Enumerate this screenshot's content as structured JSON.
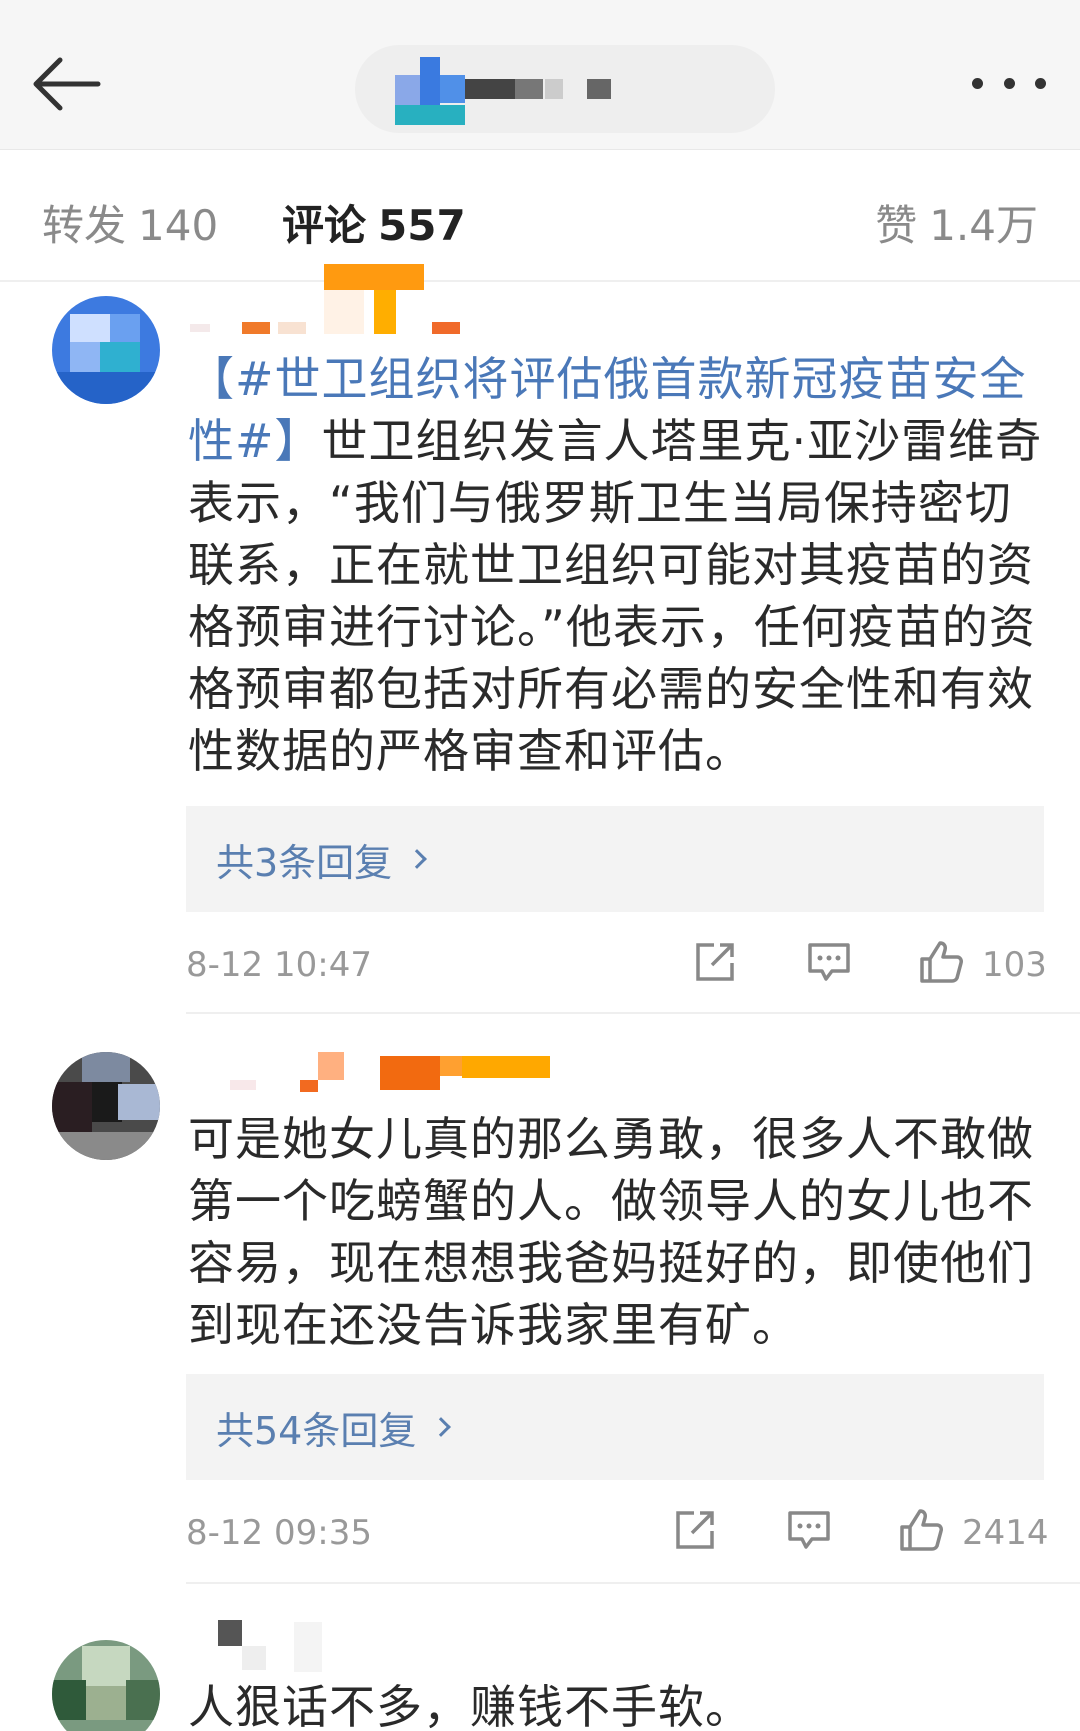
{
  "tabs": {
    "repost_label": "转发",
    "repost_count": "140",
    "comments_label": "评论",
    "comments_count": "557",
    "likes_label": "赞",
    "likes_count": "1.4万"
  },
  "comments": [
    {
      "topic": "【#世卫组织将评估俄首款新冠疫苗安全性#】",
      "text": "世卫组织发言人塔里克·亚沙雷维奇表示，“我们与俄罗斯卫生当局保持密切联系，正在就世卫组织可能对其疫苗的资格预审进行讨论。”他表示，任何疫苗的资格预审都包括对所有必需的安全性和有效性数据的严格审查和评估。",
      "replies": "共3条回复",
      "time": "8-12 10:47",
      "likes": "103"
    },
    {
      "text": "可是她女儿真的那么勇敢，很多人不敢做第一个吃螃蟹的人。做领导人的女儿也不容易，现在想想我爸妈挺好的，即使他们到现在还没告诉我家里有矿。",
      "replies": "共54条回复",
      "time": "8-12 09:35",
      "likes": "2414"
    },
    {
      "text": "人狠话不多，赚钱不手软。"
    }
  ],
  "icons": {
    "back": "arrow-left-icon",
    "more": "more-dots-icon",
    "share": "share-icon",
    "comment": "comment-icon",
    "like": "thumbs-up-icon"
  },
  "colors": {
    "link": "#4a78b8",
    "muted": "#999999",
    "topbar": "#f6f6f6"
  }
}
